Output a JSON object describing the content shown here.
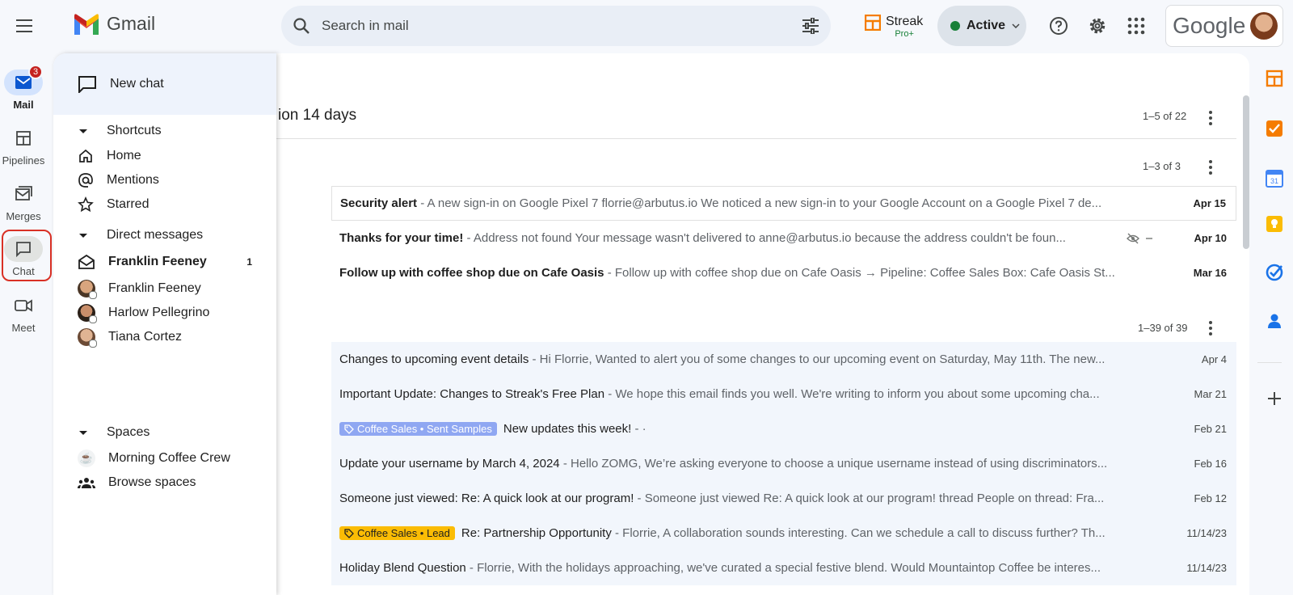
{
  "header": {
    "app_name": "Gmail",
    "search_placeholder": "Search in mail",
    "streak_name": "Streak",
    "streak_tier": "Pro+",
    "status_label": "Active",
    "account_brand": "Google"
  },
  "rail": {
    "mail": {
      "label": "Mail",
      "badge": "3"
    },
    "pipelines": {
      "label": "Pipelines"
    },
    "merges": {
      "label": "Merges"
    },
    "chat": {
      "label": "Chat"
    },
    "meet": {
      "label": "Meet"
    }
  },
  "chat_panel": {
    "new_chat": "New chat",
    "shortcuts": {
      "title": "Shortcuts",
      "items": [
        "Home",
        "Mentions",
        "Starred"
      ]
    },
    "direct_messages": {
      "title": "Direct messages",
      "items": [
        {
          "name": "Franklin Feeney",
          "unread": "1"
        },
        {
          "name": "Franklin Feeney"
        },
        {
          "name": "Harlow Pellegrino"
        },
        {
          "name": "Tiana Cortez"
        }
      ]
    },
    "spaces": {
      "title": "Spaces",
      "items": [
        "Morning Coffee Crew",
        "Browse spaces"
      ]
    }
  },
  "main": {
    "section_title": "ion 14 days",
    "section_count": "1–5 of 22",
    "group1_count": "1–3 of 3",
    "group2_count": "1–39 of 39",
    "important": [
      {
        "subject": "Security alert",
        "snippet": " - A new sign-in on Google Pixel 7 florrie@arbutus.io We noticed a new sign-in to your Google Account on a Google Pixel 7 de...",
        "date": "Apr 15"
      },
      {
        "subject": "Thanks for your time!",
        "snippet": " - Address not found Your message wasn't delivered to anne@arbutus.io because the address couldn't be foun...",
        "date": "Apr 10"
      },
      {
        "subject": "Follow up with coffee shop due on Cafe Oasis",
        "snippet": " - Follow up with coffee shop due on Cafe Oasis → Pipeline: Coffee Sales Box: Cafe Oasis St...",
        "date": "Mar 16"
      }
    ],
    "others": [
      {
        "label": "",
        "subject": "Changes to upcoming event details",
        "snippet": " - Hi Florrie, Wanted to alert you of some changes to our upcoming event on Saturday, May 11th. The new...",
        "date": "Apr 4"
      },
      {
        "label": "",
        "subject": "Important Update: Changes to Streak's Free Plan",
        "snippet": " - We hope this email finds you well. We're writing to inform you about some upcoming cha...",
        "date": "Mar 21"
      },
      {
        "label": "Coffee Sales • Sent Samples",
        "subject": "New updates this week!",
        "snippet": " - ·",
        "date": "Feb 21"
      },
      {
        "label": "",
        "subject": "Update your username by March 4, 2024",
        "snippet": " - Hello ZOMG, We’re asking everyone to choose a unique username instead of using discriminators...",
        "date": "Feb 16"
      },
      {
        "label": "",
        "subject": "Someone just viewed: Re: A quick look at our program!",
        "snippet": " - Someone just viewed Re: A quick look at our program! thread People on thread: Fra...",
        "date": "Feb 12"
      },
      {
        "label": "Coffee Sales • Lead",
        "subject": "Re: Partnership Opportunity",
        "snippet": " - Florrie, A collaboration sounds interesting. Can we schedule a call to discuss further? Th...",
        "date": "11/14/23"
      },
      {
        "label": "",
        "subject": "Holiday Blend Question",
        "snippet": " - Florrie, With the holidays approaching, we've curated a special festive blend. Would Mountaintop Coffee be interes...",
        "date": "11/14/23"
      }
    ]
  },
  "colors": {
    "chip_sent_samples": "#8fa7f2",
    "chip_lead": "#fbbc04",
    "chat_highlight": "#d93025",
    "active_green": "#188038"
  }
}
